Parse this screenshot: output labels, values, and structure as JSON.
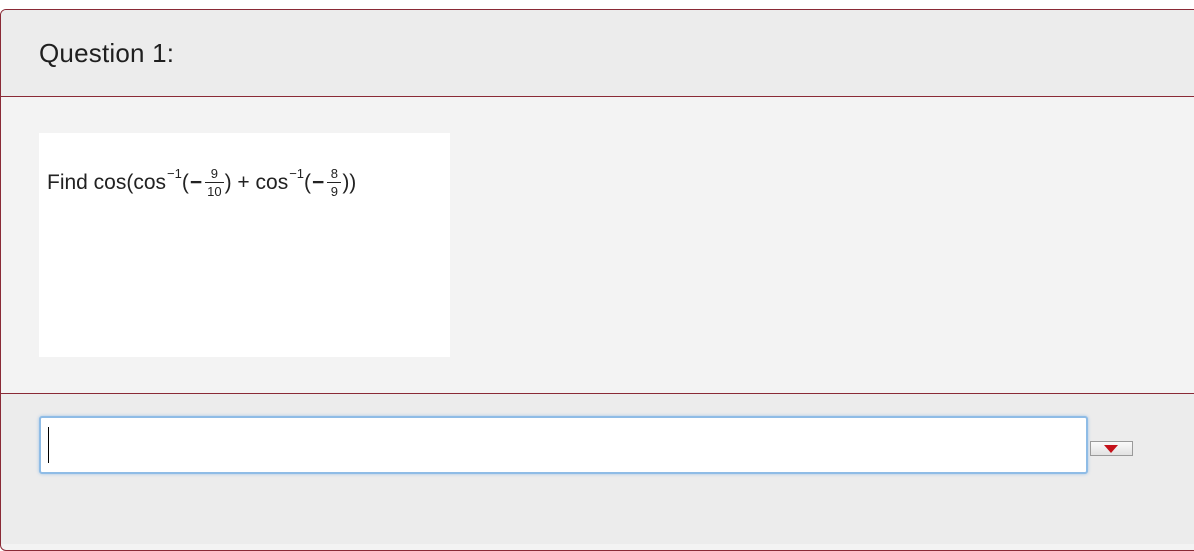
{
  "question": {
    "title": "Question 1:",
    "prompt": {
      "find": "Find cos(cos",
      "inv1": "−1",
      "open1": "(",
      "neg1": "−",
      "frac1_num": "9",
      "frac1_den": "10",
      "close1": ") + cos",
      "inv2": "−1",
      "open2": "(",
      "neg2": "−",
      "frac2_num": "8",
      "frac2_den": "9",
      "close2": "))"
    }
  },
  "answer": {
    "value": "",
    "placeholder": ""
  },
  "icons": {
    "dropdown": "caret-down-icon",
    "dropdown_color": "#c4121a"
  },
  "colors": {
    "border": "#8a2a36",
    "input_focus": "#8fbce6"
  }
}
